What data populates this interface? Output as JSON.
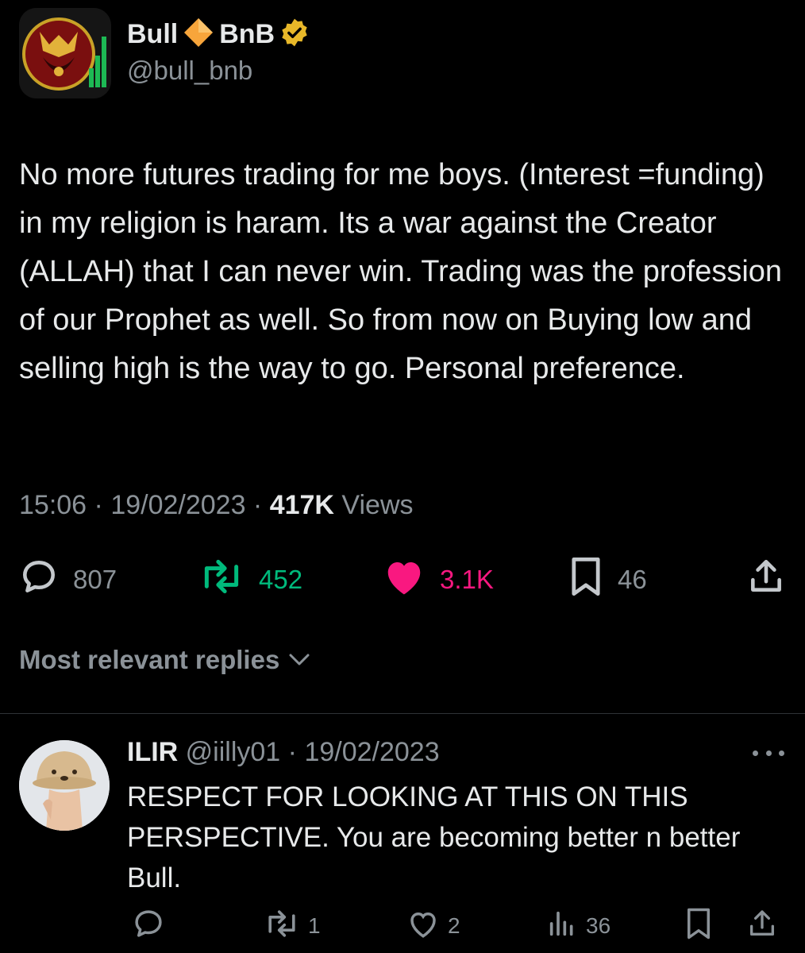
{
  "tweet": {
    "author_name": "Bull",
    "author_name_suffix": "BnB",
    "handle": "@bull_bnb",
    "text": "No more futures trading for me boys. (Interest =funding) in my religion is haram. Its a war against the Creator (ALLAH) that I can never win. Trading was the profession of our Prophet as well. So from now on Buying low and selling high is the way to go. Personal preference.",
    "time": "15:06",
    "separator": " · ",
    "date": "19/02/2023",
    "views_count": "417K",
    "views_label": " Views",
    "stats": {
      "replies": "807",
      "retweets": "452",
      "likes": "3.1K",
      "bookmarks": "46"
    },
    "colors": {
      "retweet": "#00ba7c",
      "like": "#f91880",
      "verified": "#e8b829",
      "diamond": "#f7a53b",
      "muted": "#8b9298"
    }
  },
  "replies_filter": {
    "label": "Most relevant replies"
  },
  "reply": {
    "name": "ILIR",
    "handle": "@iilly01",
    "date": "19/02/2023",
    "text": "RESPECT FOR LOOKING AT THIS ON THIS PERSPECTIVE. You are becoming better n better Bull.",
    "stats": {
      "retweets": "1",
      "likes": "2",
      "views": "36"
    }
  },
  "icons": {
    "verified": "verified-badge-icon",
    "diamond": "diamond-icon",
    "reply": "reply-icon",
    "retweet": "retweet-icon",
    "like": "heart-icon",
    "bookmark": "bookmark-icon",
    "share": "share-icon",
    "more": "more-icon",
    "views": "views-icon",
    "chevron": "chevron-down-icon"
  }
}
